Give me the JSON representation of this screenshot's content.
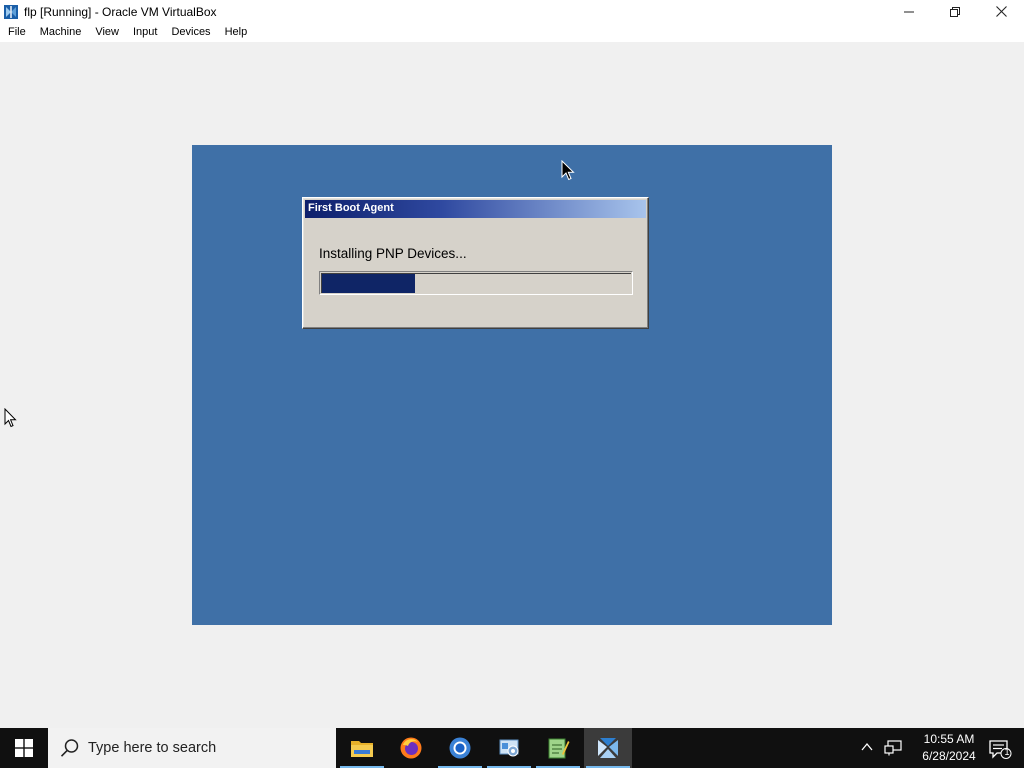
{
  "window": {
    "title": "flp [Running] - Oracle VM VirtualBox",
    "controls": {
      "minimize": "—",
      "restore": "❐",
      "close": "✕"
    }
  },
  "menu": {
    "items": [
      {
        "label": "File"
      },
      {
        "label": "Machine"
      },
      {
        "label": "View"
      },
      {
        "label": "Input"
      },
      {
        "label": "Devices"
      },
      {
        "label": "Help"
      }
    ]
  },
  "guest": {
    "background": "#3f70a7",
    "dialog": {
      "title": "First Boot Agent",
      "message": "Installing PNP Devices...",
      "progress_fraction": 0.3
    }
  },
  "taskbar": {
    "search_placeholder": "Type here to search",
    "apps": [
      {
        "name": "file-explorer-icon",
        "active": true
      },
      {
        "name": "firefox-icon",
        "active": false
      },
      {
        "name": "chrome-icon",
        "active": true
      },
      {
        "name": "control-panel-icon",
        "active": true
      },
      {
        "name": "notepad-icon",
        "active": true
      },
      {
        "name": "virtualbox-icon",
        "active": true,
        "current": true
      }
    ],
    "clock": {
      "time": "10:55 AM",
      "date": "6/28/2024"
    },
    "notification_count": "1"
  }
}
